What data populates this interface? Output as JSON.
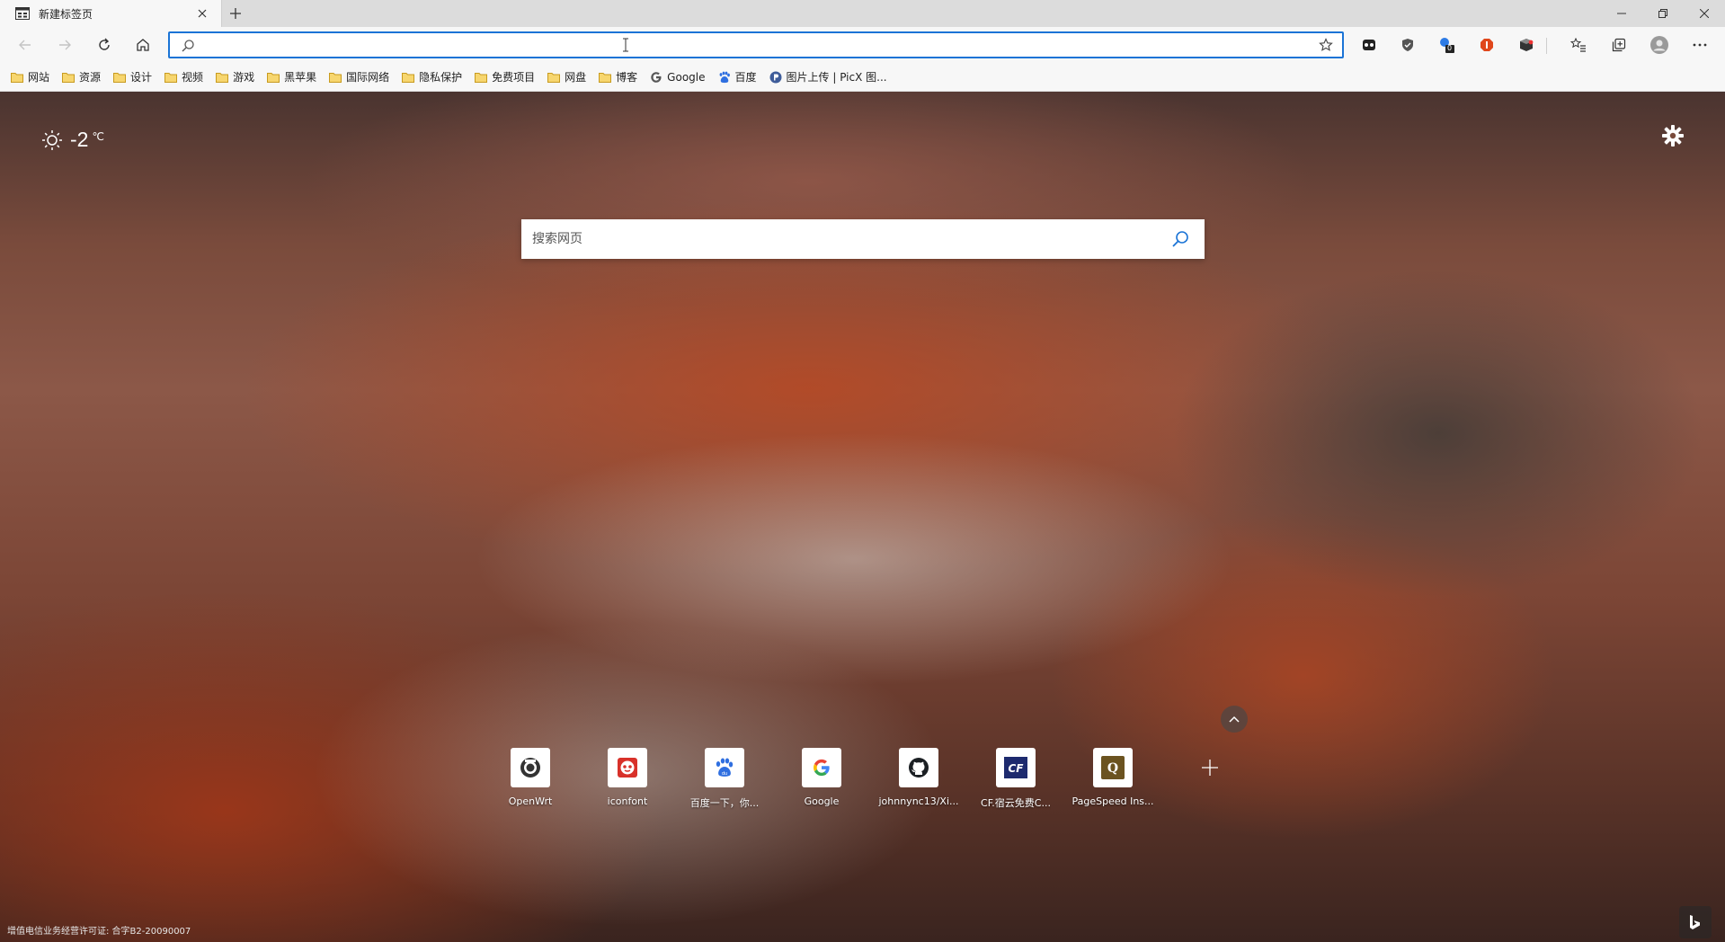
{
  "tab": {
    "title": "新建标签页"
  },
  "address_bar": {
    "value": "",
    "placeholder": ""
  },
  "bookmarks": [
    {
      "label": "网站",
      "icon": "folder-icon"
    },
    {
      "label": "资源",
      "icon": "folder-icon"
    },
    {
      "label": "设计",
      "icon": "folder-icon"
    },
    {
      "label": "视频",
      "icon": "folder-icon"
    },
    {
      "label": "游戏",
      "icon": "folder-icon"
    },
    {
      "label": "黑苹果",
      "icon": "folder-icon"
    },
    {
      "label": "国际网络",
      "icon": "folder-icon"
    },
    {
      "label": "隐私保护",
      "icon": "folder-icon"
    },
    {
      "label": "免费项目",
      "icon": "folder-icon"
    },
    {
      "label": "网盘",
      "icon": "folder-icon"
    },
    {
      "label": "博客",
      "icon": "folder-icon"
    },
    {
      "label": "Google",
      "icon": "google-icon"
    },
    {
      "label": "百度",
      "icon": "baidu-icon"
    },
    {
      "label": "图片上传 | PicX 图...",
      "icon": "picx-icon"
    }
  ],
  "extensions": {
    "badge_count": "0"
  },
  "weather": {
    "temperature": "-2",
    "unit": "℃"
  },
  "search": {
    "placeholder": "搜索网页"
  },
  "quick_links": [
    {
      "label": "OpenWrt",
      "icon": "openwrt-icon"
    },
    {
      "label": "iconfont",
      "icon": "iconfont-icon"
    },
    {
      "label": "百度一下，你...",
      "icon": "baidu-icon"
    },
    {
      "label": "Google",
      "icon": "google-icon"
    },
    {
      "label": "johnnync13/Xi...",
      "icon": "github-icon"
    },
    {
      "label": "CF.宿云免费C...",
      "icon": "cf-icon"
    },
    {
      "label": "PageSpeed Ins...",
      "icon": "pagespeed-icon"
    }
  ],
  "footer": {
    "license": "增值电信业务经营许可证: 合字B2-20090007"
  },
  "colors": {
    "accent": "#1b74d6",
    "toolbar_bg": "#f7f7f7",
    "folder": "#f0c330"
  }
}
